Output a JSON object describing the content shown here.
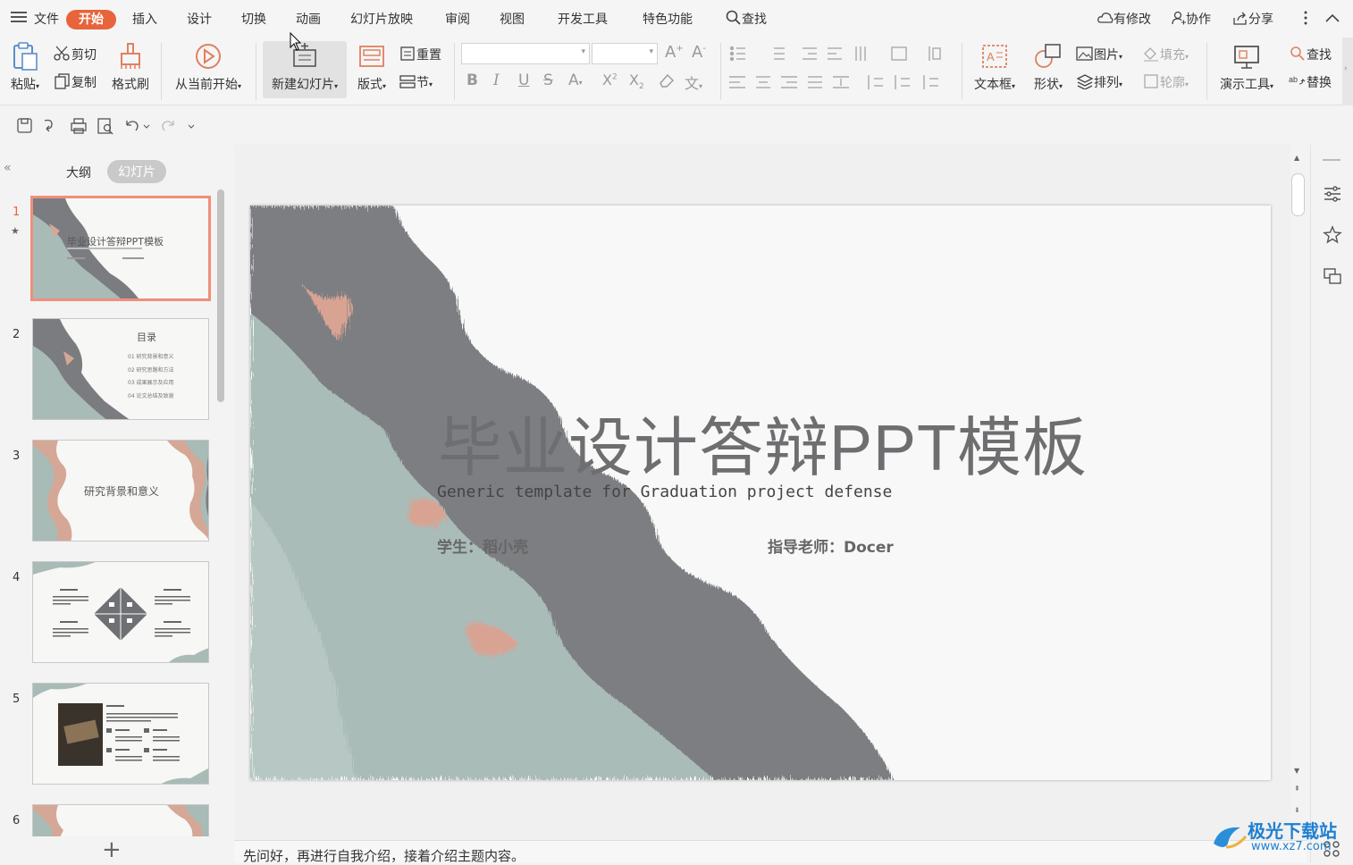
{
  "menu": {
    "file": "文件",
    "tabs": [
      "开始",
      "插入",
      "设计",
      "切换",
      "动画",
      "幻灯片放映",
      "审阅",
      "视图",
      "开发工具",
      "特色功能"
    ],
    "search": "查找",
    "right": [
      "有修改",
      "协作",
      "分享"
    ]
  },
  "ribbon": {
    "paste": "粘贴",
    "cut": "剪切",
    "copy": "复制",
    "format_painter": "格式刷",
    "from_current": "从当前开始",
    "new_slide": "新建幻灯片",
    "layout": "版式",
    "reset": "重置",
    "section": "节",
    "textbox": "文本框",
    "shape": "形状",
    "picture": "图片",
    "arrange": "排列",
    "fill": "填充",
    "outline": "轮廓",
    "present_tools": "演示工具",
    "find": "查找",
    "replace": "替换"
  },
  "panel": {
    "tab_outline": "大纲",
    "tab_slides": "幻灯片",
    "numbers": [
      "1",
      "2",
      "3",
      "4",
      "5",
      "6"
    ],
    "thumb1_title": "毕业设计答辩PPT模板",
    "thumb2_title": "目录",
    "thumb2_items": [
      "01  研究背景和意义",
      "02  研究思路和方法",
      "03  成果展示及应用",
      "04  论文总结及致谢"
    ],
    "thumb3_title": "研究背景和意义"
  },
  "slide": {
    "title": "毕业设计答辩PPT模板",
    "subtitle": "Generic template for Graduation project defense",
    "student": "学生：稻小壳",
    "advisor": "指导老师：Docer"
  },
  "notes": "先问好，再进行自我介绍，接着介绍主题内容。",
  "watermark": {
    "name": "极光下载站",
    "url": "www.xz7.com"
  },
  "colors": {
    "accent": "#e8643c",
    "selected_border": "#f08f7a",
    "slide_gray": "#7d7d80",
    "slide_teal": "#a9bcb8",
    "slide_pink": "#d9a393"
  }
}
